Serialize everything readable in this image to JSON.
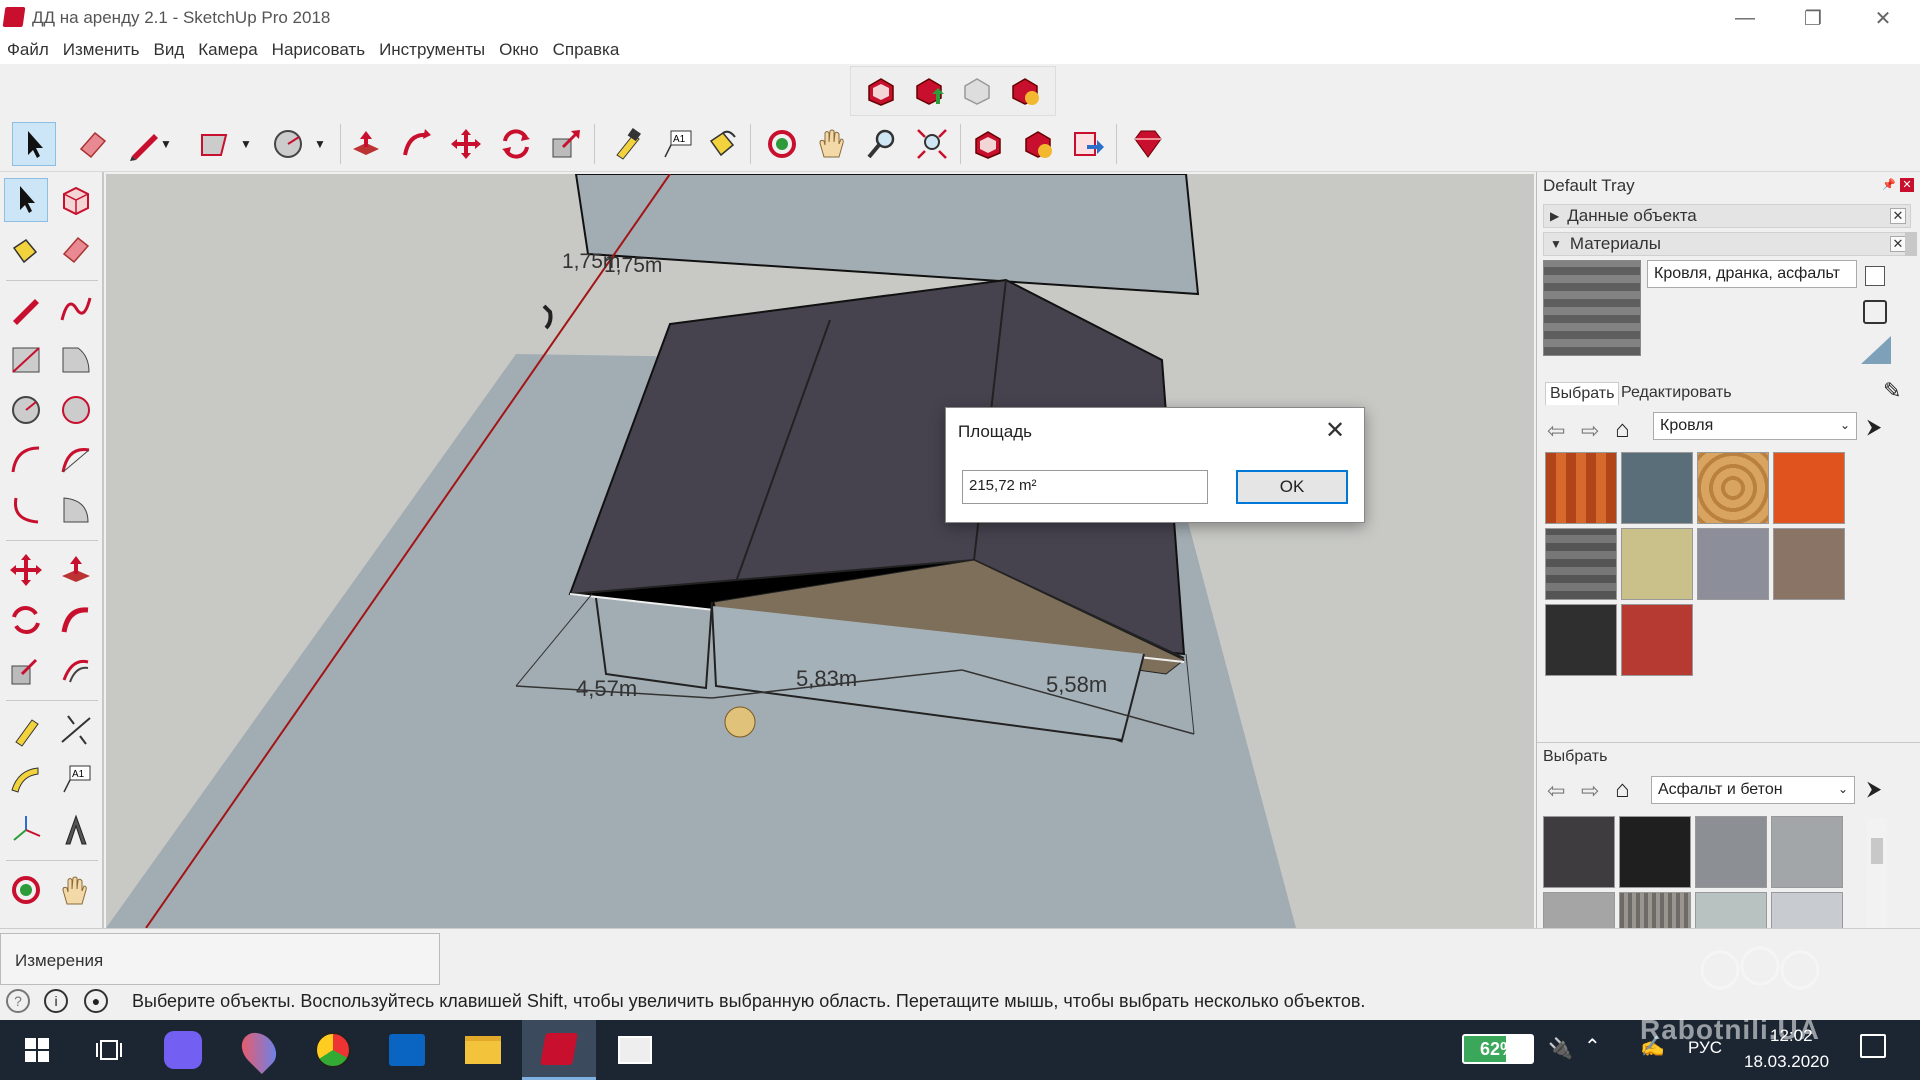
{
  "window": {
    "title": "ДД на аренду 2.1 - SketchUp Pro 2018",
    "min": "—",
    "restore": "❐",
    "close": "✕"
  },
  "menu": [
    "Файл",
    "Изменить",
    "Вид",
    "Камера",
    "Нарисовать",
    "Инструменты",
    "Окно",
    "Справка"
  ],
  "viewport": {
    "dims": [
      "4,57m",
      "5,83m",
      "5,58m"
    ],
    "dim_top": "1,75m",
    "dim_top2": "1,75m"
  },
  "dialog": {
    "title": "Площадь",
    "value": "215,72 m²",
    "ok": "OK",
    "close": "✕"
  },
  "tray": {
    "title": "Default Tray",
    "sections": [
      "Данные объекта",
      "Материалы"
    ],
    "material_name": "Кровля, дранка, асфальт",
    "tab_select": "Выбрать",
    "tab_edit": "Редактировать",
    "collection": "Кровля",
    "second_label": "Выбрать",
    "collection2": "Асфальт и бетон",
    "accent": "#cde6f7"
  },
  "status": {
    "measure_label": "Измерения",
    "text": "Выберите объекты. Воспользуйтесь клавишей Shift, чтобы увеличить выбранную область. Перетащите мышь, чтобы выбрать несколько объектов."
  },
  "taskbar": {
    "battery": "62%",
    "battery_level": 0.62,
    "lang": "РУС",
    "time": "12:02",
    "date": "18.03.2020"
  },
  "watermark": "Rabotnili.UA"
}
